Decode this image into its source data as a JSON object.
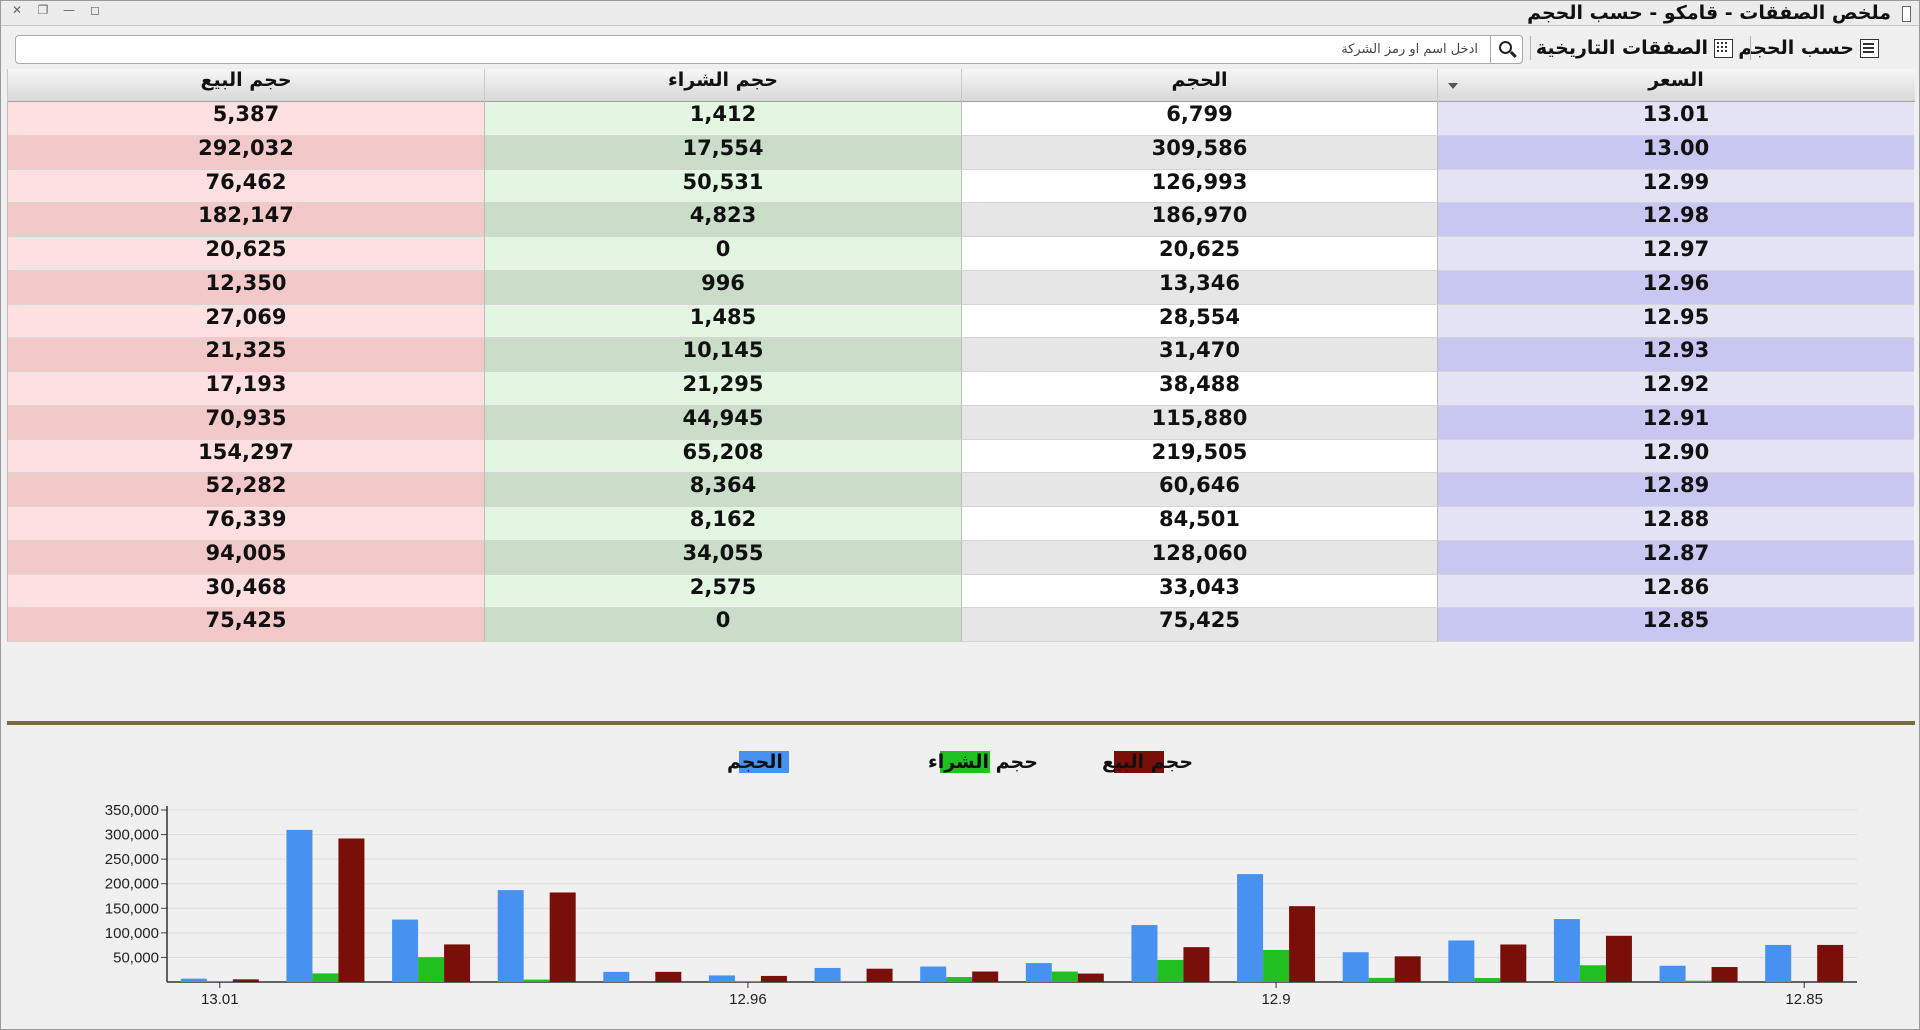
{
  "window": {
    "title": "ملخص الصفقات - قامكو - حسب الحجم",
    "controls": [
      "✕",
      "❐",
      "—",
      "◻"
    ]
  },
  "toolbar": {
    "by_volume_label": "حسب الحجم",
    "historical_label": "الصفقات التاريخية",
    "search_placeholder": "ادخل اسم او رمز الشركة"
  },
  "grid": {
    "columns": [
      "حجم البيع",
      "حجم الشراء",
      "الحجم",
      "السعر"
    ],
    "rows": [
      [
        "5,387",
        "1,412",
        "6,799",
        "13.01"
      ],
      [
        "292,032",
        "17,554",
        "309,586",
        "13.00"
      ],
      [
        "76,462",
        "50,531",
        "126,993",
        "12.99"
      ],
      [
        "182,147",
        "4,823",
        "186,970",
        "12.98"
      ],
      [
        "20,625",
        "0",
        "20,625",
        "12.97"
      ],
      [
        "12,350",
        "996",
        "13,346",
        "12.96"
      ],
      [
        "27,069",
        "1,485",
        "28,554",
        "12.95"
      ],
      [
        "21,325",
        "10,145",
        "31,470",
        "12.93"
      ],
      [
        "17,193",
        "21,295",
        "38,488",
        "12.92"
      ],
      [
        "70,935",
        "44,945",
        "115,880",
        "12.91"
      ],
      [
        "154,297",
        "65,208",
        "219,505",
        "12.90"
      ],
      [
        "52,282",
        "8,364",
        "60,646",
        "12.89"
      ],
      [
        "76,339",
        "8,162",
        "84,501",
        "12.88"
      ],
      [
        "94,005",
        "34,055",
        "128,060",
        "12.87"
      ],
      [
        "30,468",
        "2,575",
        "33,043",
        "12.86"
      ],
      [
        "75,425",
        "0",
        "75,425",
        "12.85"
      ]
    ]
  },
  "chart_data": {
    "type": "bar",
    "categories": [
      "13.01",
      "13.00",
      "12.99",
      "12.98",
      "12.97",
      "12.96",
      "12.95",
      "12.93",
      "12.92",
      "12.91",
      "12.90",
      "12.89",
      "12.88",
      "12.87",
      "12.86",
      "12.85"
    ],
    "tick_labels": [
      "13.01",
      "12.96",
      "12.9",
      "12.85"
    ],
    "series": [
      {
        "name": "الحجم",
        "color": "#4791f0",
        "values": [
          6799,
          309586,
          126993,
          186970,
          20625,
          13346,
          28554,
          31470,
          38488,
          115880,
          219505,
          60646,
          84501,
          128060,
          33043,
          75425
        ]
      },
      {
        "name": "حجم الشراء",
        "color": "#21c021",
        "values": [
          1412,
          17554,
          50531,
          4823,
          0,
          996,
          1485,
          10145,
          21295,
          44945,
          65208,
          8364,
          8162,
          34055,
          2575,
          0
        ]
      },
      {
        "name": "حجم البيع",
        "color": "#7a0e08",
        "values": [
          5387,
          292032,
          76462,
          182147,
          20625,
          12350,
          27069,
          21325,
          17193,
          70935,
          154297,
          52282,
          76339,
          94005,
          30468,
          75425
        ]
      }
    ],
    "legend_order": [
      "حجم البيع",
      "حجم الشراء",
      "الحجم"
    ],
    "yticks": [
      50000,
      100000,
      150000,
      200000,
      250000,
      300000,
      350000
    ],
    "ytick_labels": [
      "50,000",
      "100,000",
      "150,000",
      "200,000",
      "250,000",
      "300,000",
      "350,000"
    ],
    "ylim": [
      0,
      350000
    ],
    "grid": true,
    "legend": "top-center"
  }
}
